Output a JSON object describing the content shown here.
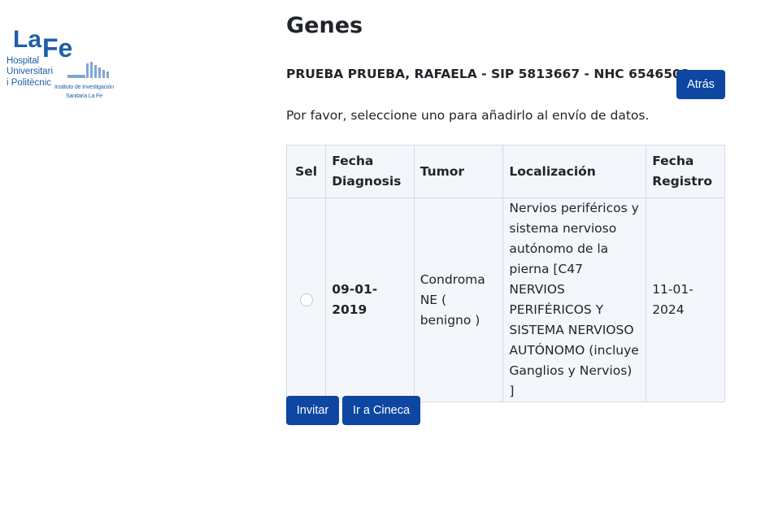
{
  "logo": {
    "brand_la": "La",
    "brand_fe": "Fe",
    "hospital_line1": "Hospital",
    "hospital_line2": "Universitari",
    "hospital_line3": "i Politècnic",
    "institute_line1": "Instituto de Investigación",
    "institute_line2": "Sanitaria La Fe",
    "brand_color": "#1f5fa8"
  },
  "page": {
    "title": "Genes",
    "patient_info": "PRUEBA PRUEBA, RAFAELA - SIP 5813667 - NHC 6546502",
    "back_button": "Atrás",
    "instructions": "Por favor, seleccione uno para añadirlo al envío de datos."
  },
  "table": {
    "headers": {
      "sel": "Sel",
      "fecha_diagnosis": "Fecha Diagnosis",
      "tumor": "Tumor",
      "localizacion": "Localización",
      "fecha_registro": "Fecha Registro"
    },
    "rows": [
      {
        "selected": false,
        "fecha_diagnosis": "09-01-2019",
        "tumor": "Condroma NE ( benigno )",
        "localizacion": "Nervios periféricos y sistema nervioso autónomo de la pierna [C47 NERVIOS PERIFÉRICOS Y SISTEMA NERVIOSO AUTÓNOMO (incluye Ganglios y Nervios) ]",
        "fecha_registro": "11-01-2024"
      }
    ]
  },
  "actions": {
    "invite_button": "Invitar",
    "cineca_button": "Ir a Cineca"
  },
  "colors": {
    "primary_button": "#0d47a1",
    "table_background": "#f3f6fb"
  }
}
